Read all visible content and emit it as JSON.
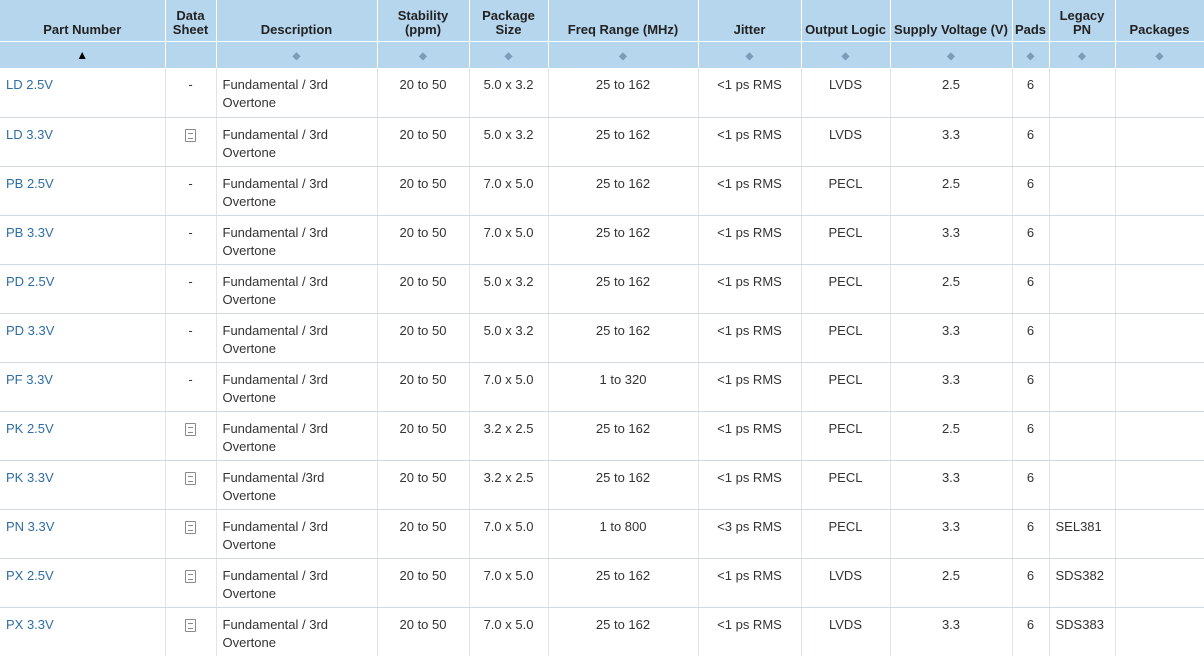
{
  "headers": [
    {
      "label": "Part Number",
      "sort": "▲"
    },
    {
      "label": "Data Sheet",
      "sort": ""
    },
    {
      "label": "Description",
      "sort": "◆"
    },
    {
      "label": "Stability (ppm)",
      "sort": "◆"
    },
    {
      "label": "Package Size",
      "sort": "◆"
    },
    {
      "label": "Freq Range (MHz)",
      "sort": "◆"
    },
    {
      "label": "Jitter",
      "sort": "◆"
    },
    {
      "label": "Output Logic",
      "sort": "◆"
    },
    {
      "label": "Supply Voltage (V)",
      "sort": "◆"
    },
    {
      "label": "Pads",
      "sort": "◆"
    },
    {
      "label": "Legacy PN",
      "sort": "◆"
    },
    {
      "label": "Packages",
      "sort": "◆"
    }
  ],
  "rows": [
    {
      "part": "LD 2.5V",
      "datasheet": "-",
      "description": "Fundamental / 3rd Overtone",
      "stability": "20 to 50",
      "package": "5.0 x 3.2",
      "freq": "25 to 162",
      "jitter": "<1 ps RMS",
      "logic": "LVDS",
      "voltage": "2.5",
      "pads": "6",
      "legacy": "",
      "packages": ""
    },
    {
      "part": "LD 3.3V",
      "datasheet": "pdf-icon",
      "description": "Fundamental / 3rd Overtone",
      "stability": "20 to 50",
      "package": "5.0 x 3.2",
      "freq": "25 to 162",
      "jitter": "<1 ps RMS",
      "logic": "LVDS",
      "voltage": "3.3",
      "pads": "6",
      "legacy": "",
      "packages": ""
    },
    {
      "part": "PB 2.5V",
      "datasheet": "-",
      "description": "Fundamental / 3rd Overtone",
      "stability": "20 to 50",
      "package": "7.0 x 5.0",
      "freq": "25 to 162",
      "jitter": "<1 ps RMS",
      "logic": "PECL",
      "voltage": "2.5",
      "pads": "6",
      "legacy": "",
      "packages": ""
    },
    {
      "part": "PB 3.3V",
      "datasheet": "-",
      "description": "Fundamental / 3rd Overtone",
      "stability": "20 to 50",
      "package": "7.0 x 5.0",
      "freq": "25 to 162",
      "jitter": "<1 ps RMS",
      "logic": "PECL",
      "voltage": "3.3",
      "pads": "6",
      "legacy": "",
      "packages": ""
    },
    {
      "part": "PD 2.5V",
      "datasheet": "-",
      "description": "Fundamental / 3rd Overtone",
      "stability": "20 to 50",
      "package": "5.0 x 3.2",
      "freq": "25 to 162",
      "jitter": "<1 ps RMS",
      "logic": "PECL",
      "voltage": "2.5",
      "pads": "6",
      "legacy": "",
      "packages": ""
    },
    {
      "part": "PD 3.3V",
      "datasheet": "-",
      "description": "Fundamental / 3rd Overtone",
      "stability": "20 to 50",
      "package": "5.0 x 3.2",
      "freq": "25 to 162",
      "jitter": "<1 ps RMS",
      "logic": "PECL",
      "voltage": "3.3",
      "pads": "6",
      "legacy": "",
      "packages": ""
    },
    {
      "part": "PF 3.3V",
      "datasheet": "-",
      "description": "Fundamental / 3rd Overtone",
      "stability": "20 to 50",
      "package": "7.0 x 5.0",
      "freq": "1 to 320",
      "jitter": "<1 ps RMS",
      "logic": "PECL",
      "voltage": "3.3",
      "pads": "6",
      "legacy": "",
      "packages": ""
    },
    {
      "part": "PK 2.5V",
      "datasheet": "pdf-icon",
      "description": "Fundamental / 3rd Overtone",
      "stability": "20 to 50",
      "package": "3.2 x 2.5",
      "freq": "25 to 162",
      "jitter": "<1 ps RMS",
      "logic": "PECL",
      "voltage": "2.5",
      "pads": "6",
      "legacy": "",
      "packages": ""
    },
    {
      "part": "PK 3.3V",
      "datasheet": "pdf-icon",
      "description": "Fundamental /3rd Overtone",
      "stability": "20 to 50",
      "package": "3.2 x 2.5",
      "freq": "25 to 162",
      "jitter": "<1 ps RMS",
      "logic": "PECL",
      "voltage": "3.3",
      "pads": "6",
      "legacy": "",
      "packages": ""
    },
    {
      "part": "PN 3.3V",
      "datasheet": "pdf-icon",
      "description": "Fundamental / 3rd Overtone",
      "stability": "20 to 50",
      "package": "7.0 x 5.0",
      "freq": "1 to 800",
      "jitter": "<3 ps RMS",
      "logic": "PECL",
      "voltage": "3.3",
      "pads": "6",
      "legacy": "SEL381",
      "packages": ""
    },
    {
      "part": "PX 2.5V",
      "datasheet": "pdf-icon",
      "description": "Fundamental / 3rd Overtone",
      "stability": "20 to 50",
      "package": "7.0 x 5.0",
      "freq": "25 to 162",
      "jitter": "<1 ps RMS",
      "logic": "LVDS",
      "voltage": "2.5",
      "pads": "6",
      "legacy": "SDS382",
      "packages": ""
    },
    {
      "part": "PX 3.3V",
      "datasheet": "pdf-icon",
      "description": "Fundamental / 3rd Overtone",
      "stability": "20 to 50",
      "package": "7.0 x 5.0",
      "freq": "25 to 162",
      "jitter": "<1 ps RMS",
      "logic": "LVDS",
      "voltage": "3.3",
      "pads": "6",
      "legacy": "SDS383",
      "packages": ""
    }
  ],
  "colors": {
    "header_bg": "#b6d6ee",
    "link": "#2e6da4"
  }
}
